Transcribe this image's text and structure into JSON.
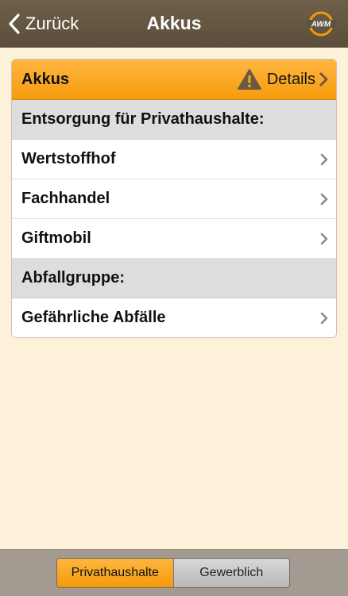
{
  "nav": {
    "back_label": "Zurück",
    "title": "Akkus",
    "logo_text": "AWM"
  },
  "card": {
    "title": "Akkus",
    "details_label": "Details",
    "sections": [
      {
        "heading": "Entsorgung für Privathaushalte:",
        "items": [
          "Wertstoffhof",
          "Fachhandel",
          "Giftmobil"
        ]
      },
      {
        "heading": "Abfallgruppe:",
        "items": [
          "Gefährliche Abfälle"
        ]
      }
    ]
  },
  "segments": {
    "options": [
      "Privathaushalte",
      "Gewerblich"
    ],
    "selected": "Privathaushalte"
  },
  "colors": {
    "accent": "#f7a51f",
    "navbar": "#655743",
    "background": "#fdf2d9",
    "section_bg": "#dddddd"
  },
  "icons": {
    "back": "chevron-left-icon",
    "warning": "warning-icon",
    "row_disclosure": "chevron-right-icon",
    "logo": "awm-logo"
  }
}
